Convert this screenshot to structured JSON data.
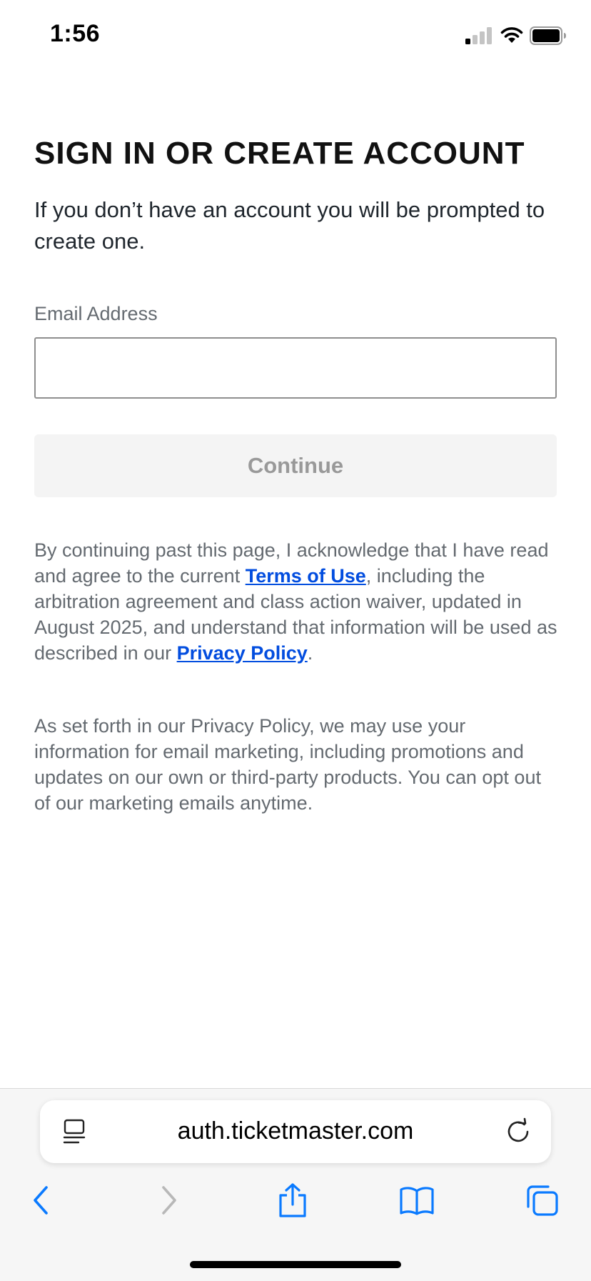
{
  "status_bar": {
    "time": "1:56"
  },
  "page": {
    "heading": "SIGN IN OR CREATE ACCOUNT",
    "subtitle": "If you don’t have an account you will be prompted to create one.",
    "email_label": "Email Address",
    "email_value": "",
    "continue_label": "Continue",
    "legal_1": {
      "part1": "By continuing past this page, I acknowledge that I have read and agree to the current ",
      "terms_link": "Terms of Use",
      "part2": ", including the arbitration agreement and class action waiver, updated in August 2025, and understand that information will be used as described in our ",
      "privacy_link": "Privacy Policy",
      "part3": "."
    },
    "legal_2": "As set forth in our Privacy Policy, we may use your information for email marketing, including promotions and updates on our own or third-party products. You can opt out of our marketing emails anytime."
  },
  "browser": {
    "url": "auth.ticketmaster.com"
  },
  "icons": [
    "signal-icon",
    "wifi-icon",
    "battery-icon",
    "reader-mode-icon",
    "reload-icon",
    "back-icon",
    "forward-icon",
    "share-icon",
    "bookmarks-icon",
    "tabs-icon"
  ],
  "colors": {
    "link": "#024ddf",
    "safari_blue": "#0a7aff",
    "disabled_button_bg": "#f4f4f4",
    "disabled_button_text": "#999999"
  }
}
